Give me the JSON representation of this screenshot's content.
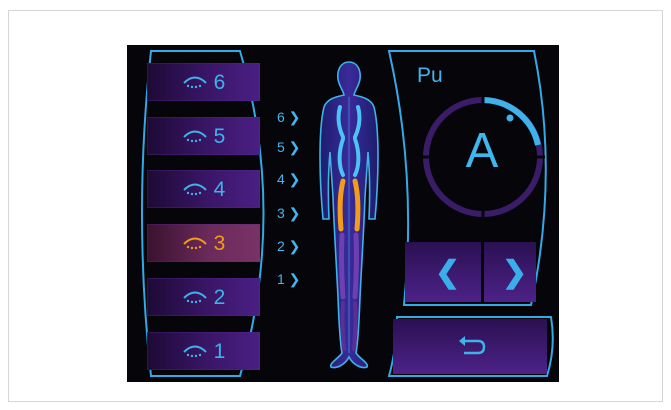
{
  "zones": [
    {
      "label": "6",
      "active": false
    },
    {
      "label": "5",
      "active": false
    },
    {
      "label": "4",
      "active": false
    },
    {
      "label": "3",
      "active": true
    },
    {
      "label": "2",
      "active": false
    },
    {
      "label": "1",
      "active": false
    }
  ],
  "zone_markers": [
    "6 ❯",
    "5 ❯",
    "4 ❯",
    "3 ❯",
    "2 ❯",
    "1 ❯"
  ],
  "panel": {
    "program": "Pu",
    "mode": "A",
    "prev": "❮",
    "next": "❯"
  },
  "colors": {
    "accent": "#3fb2ea",
    "active": "#f39b1b",
    "purple": "#4a1f84"
  }
}
